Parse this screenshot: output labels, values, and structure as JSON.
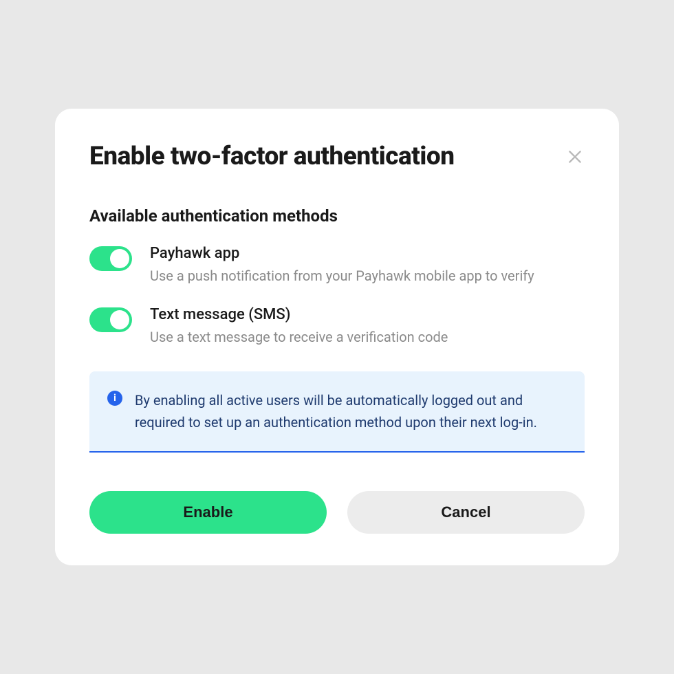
{
  "modal": {
    "title": "Enable two-factor authentication",
    "section_title": "Available authentication methods",
    "methods": [
      {
        "title": "Payhawk app",
        "description": "Use a push notification from your Payhawk mobile app to verify",
        "enabled": true
      },
      {
        "title": "Text message (SMS)",
        "description": "Use a text message to receive a verification code",
        "enabled": true
      }
    ],
    "info_text": "By enabling all active users will be automatically logged out and required to set up an authentication method upon their next log-in.",
    "buttons": {
      "primary": "Enable",
      "secondary": "Cancel"
    }
  },
  "colors": {
    "accent_green": "#2ce28b",
    "info_blue": "#2563eb",
    "info_bg": "#e8f3fd",
    "text_dark": "#1a1a1a",
    "text_muted": "#8a8a8a"
  }
}
